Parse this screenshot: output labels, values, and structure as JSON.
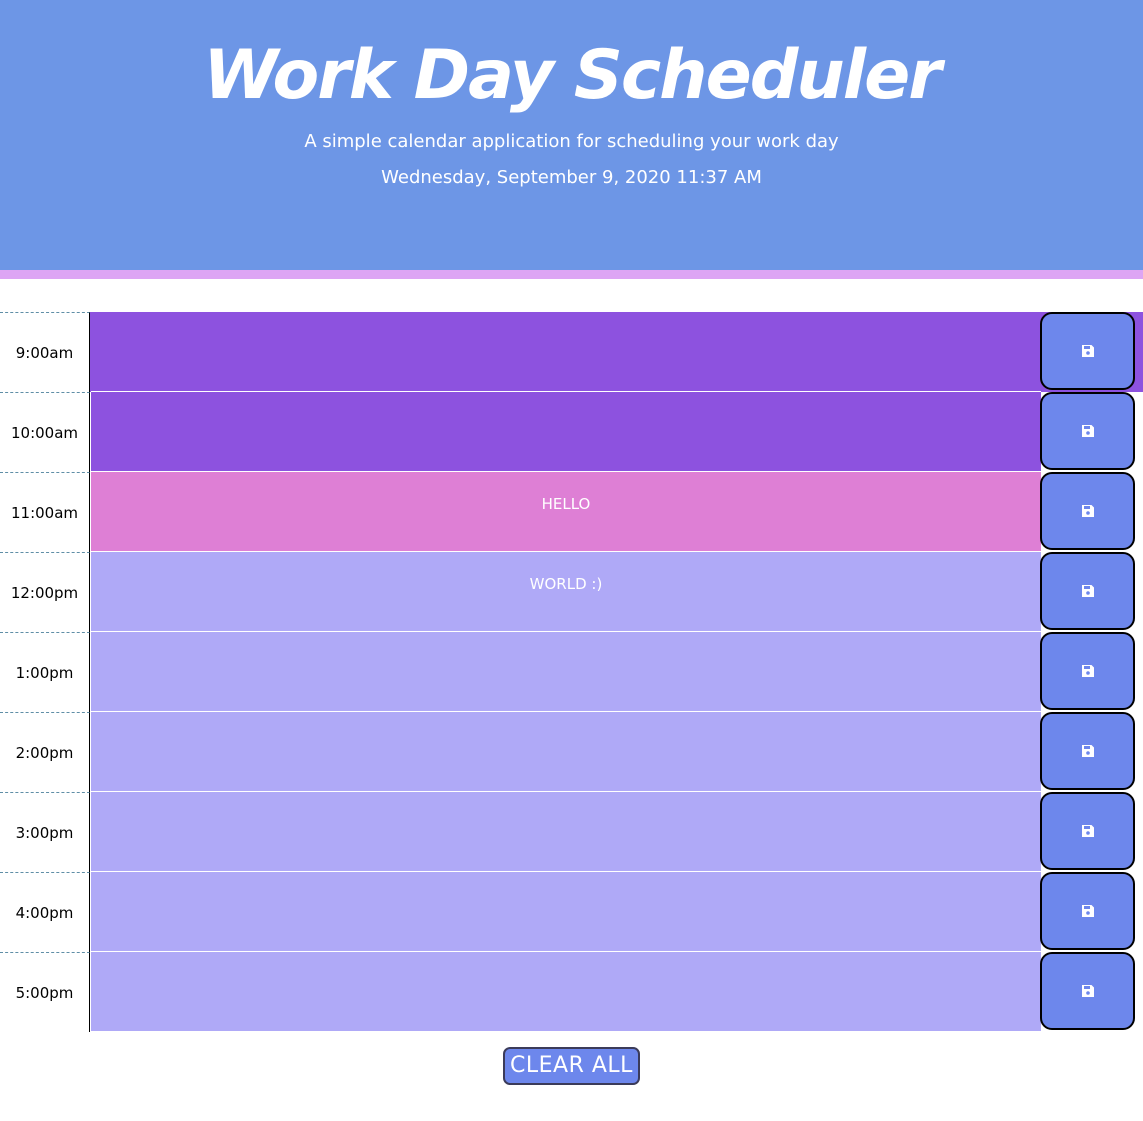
{
  "header": {
    "title": "Work Day Scheduler",
    "lead": "A simple calendar application for scheduling your work day",
    "current_day": "Wednesday, September 9, 2020 11:37 AM"
  },
  "colors": {
    "header_bg": "#6d96e6",
    "header_border": "#dda5f4",
    "past": "#8d52df",
    "present": "#de7fd5",
    "future": "#afa9f7",
    "save_button": "#6d87ec"
  },
  "schedule": {
    "rows": [
      {
        "hour": "9:00am",
        "text": "",
        "state": "past"
      },
      {
        "hour": "10:00am",
        "text": "",
        "state": "past"
      },
      {
        "hour": "11:00am",
        "text": "HELLO",
        "state": "present"
      },
      {
        "hour": "12:00pm",
        "text": "WORLD :)",
        "state": "future"
      },
      {
        "hour": "1:00pm",
        "text": "",
        "state": "future"
      },
      {
        "hour": "2:00pm",
        "text": "",
        "state": "future"
      },
      {
        "hour": "3:00pm",
        "text": "",
        "state": "future"
      },
      {
        "hour": "4:00pm",
        "text": "",
        "state": "future"
      },
      {
        "hour": "5:00pm",
        "text": "",
        "state": "future"
      }
    ],
    "save_icon": "floppy-disk-icon"
  },
  "footer": {
    "clear_label": "CLEAR ALL"
  }
}
